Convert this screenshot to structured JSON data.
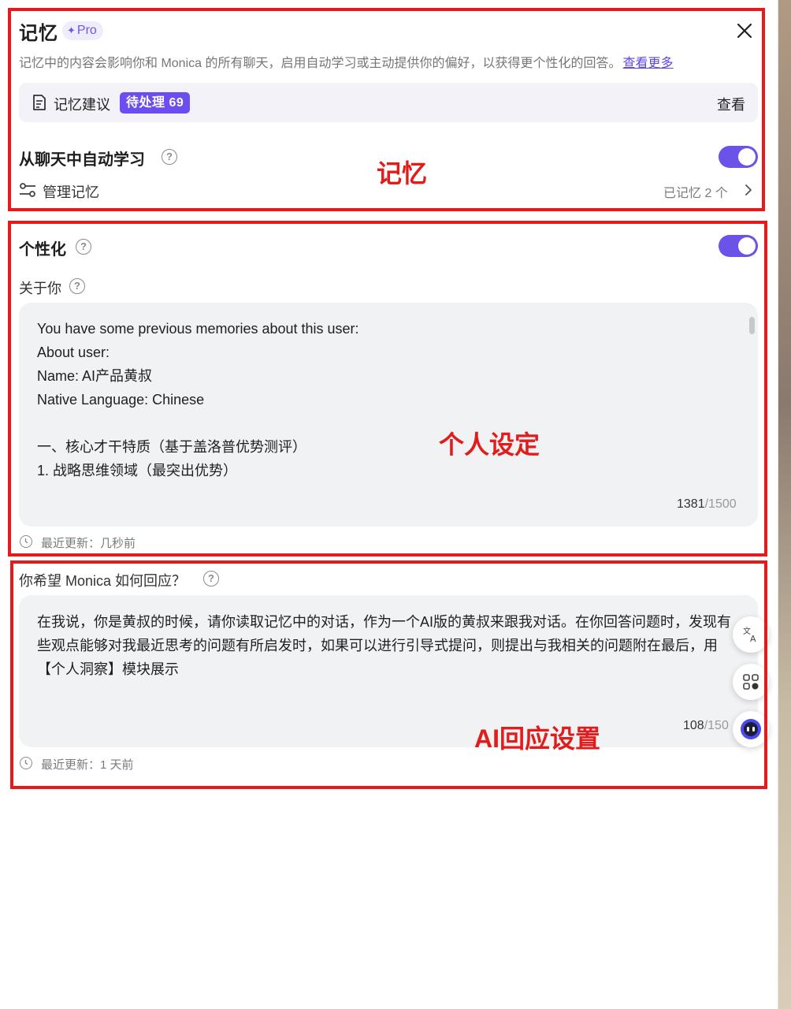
{
  "memory": {
    "title": "记忆",
    "pro_badge": "Pro",
    "description": "记忆中的内容会影响你和 Monica 的所有聊天，启用自动学习或主动提供你的偏好，以获得更个性化的回答。",
    "learn_more": "查看更多",
    "suggestions_label": "记忆建议",
    "pending_badge": "待处理 69",
    "view_label": "查看",
    "auto_learn_label": "从聊天中自动学习",
    "auto_learn_enabled": true,
    "manage_label": "管理记忆",
    "memory_count": "已记忆 2 个"
  },
  "personalization": {
    "title": "个性化",
    "enabled": true,
    "about_label": "关于你",
    "about_text": "You have some previous memories about this user:\nAbout user:\nName: AI产品黄叔\nNative Language: Chinese\n\n一、核心才干特质（基于盖洛普优势测评）\n1. 战略思维领域（最突出优势）",
    "about_count": "1381",
    "about_max": "/1500",
    "about_updated": "最近更新：几秒前"
  },
  "response": {
    "label": "你希望 Monica 如何回应？",
    "text": "在我说，你是黄叔的时候，请你读取记忆中的对话，作为一个AI版的黄叔来跟我对话。在你回答问题时，发现有些观点能够对我最近思考的问题有所启发时，如果可以进行引导式提问，则提出与我相关的问题附在最后，用【个人洞察】模块展示",
    "count": "108",
    "max": "/150",
    "updated": "最近更新：1 天前"
  },
  "annotations": {
    "memory": "记忆",
    "personal": "个人设定",
    "ai_response": "AI回应设置"
  },
  "colors": {
    "accent": "#6b52e8",
    "annotation_red": "#e61a1a",
    "link": "#5b47e6"
  },
  "icons": [
    "close-icon",
    "suggestion-doc-icon",
    "help-icon",
    "manage-sliders-icon",
    "chevron-right-icon",
    "clock-icon",
    "translate-icon",
    "apps-icon",
    "monica-bot-icon"
  ]
}
